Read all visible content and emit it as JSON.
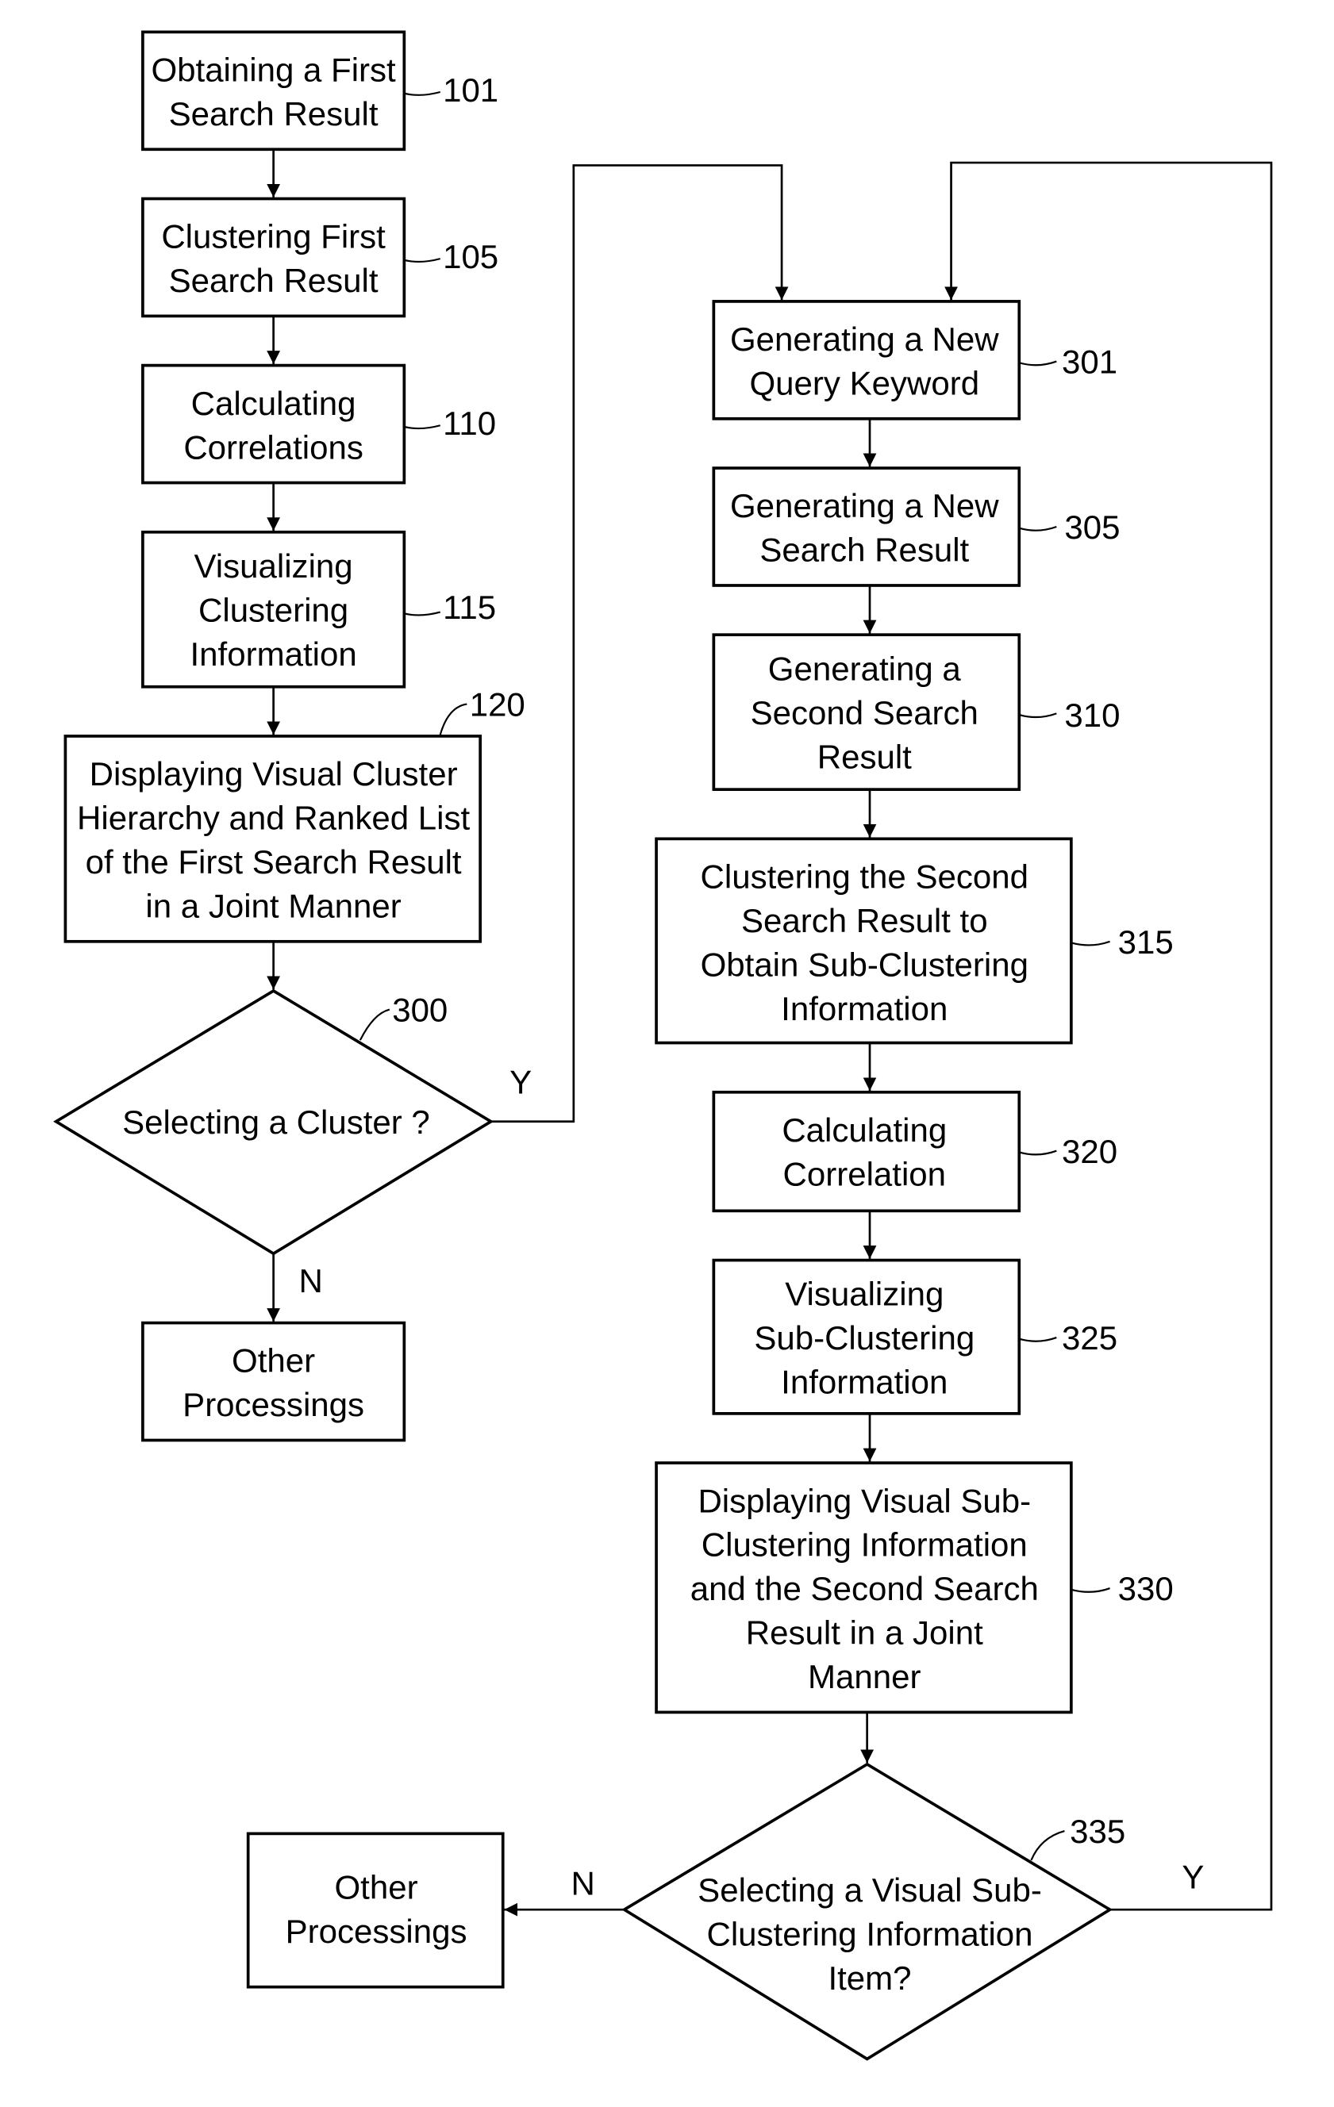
{
  "flowchart": {
    "nodes": {
      "n101": {
        "ref": "101",
        "lines": [
          "Obtaining a First",
          "Search Result"
        ]
      },
      "n105": {
        "ref": "105",
        "lines": [
          "Clustering First",
          "Search Result"
        ]
      },
      "n110": {
        "ref": "110",
        "lines": [
          "Calculating",
          "Correlations"
        ]
      },
      "n115": {
        "ref": "115",
        "lines": [
          "Visualizing",
          "Clustering",
          "Information"
        ]
      },
      "n120": {
        "ref": "120",
        "lines": [
          "Displaying Visual Cluster",
          "Hierarchy and Ranked List",
          "of the First Search Result",
          "in a Joint Manner"
        ]
      },
      "n300": {
        "ref": "300",
        "lines": [
          "Selecting a Cluster ?"
        ]
      },
      "other1": {
        "lines": [
          "Other",
          "Processings"
        ]
      },
      "n301": {
        "ref": "301",
        "lines": [
          "Generating a New",
          "Query Keyword"
        ]
      },
      "n305": {
        "ref": "305",
        "lines": [
          "Generating a New",
          "Search Result"
        ]
      },
      "n310": {
        "ref": "310",
        "lines": [
          "Generating a",
          "Second Search",
          "Result"
        ]
      },
      "n315": {
        "ref": "315",
        "lines": [
          "Clustering the Second",
          "Search Result to",
          "Obtain Sub-Clustering",
          "Information"
        ]
      },
      "n320": {
        "ref": "320",
        "lines": [
          "Calculating",
          "Correlation"
        ]
      },
      "n325": {
        "ref": "325",
        "lines": [
          "Visualizing",
          "Sub-Clustering",
          "Information"
        ]
      },
      "n330": {
        "ref": "330",
        "lines": [
          "Displaying Visual Sub-",
          "Clustering Information",
          "and the Second Search",
          "Result in a Joint",
          "Manner"
        ]
      },
      "n335": {
        "ref": "335",
        "lines": [
          "Selecting a Visual Sub-",
          "Clustering Information",
          "Item?"
        ]
      },
      "other2": {
        "lines": [
          "Other",
          "Processings"
        ]
      }
    },
    "branch_labels": {
      "n300_yes": "Y",
      "n300_no": "N",
      "n335_yes": "Y",
      "n335_no": "N"
    }
  }
}
